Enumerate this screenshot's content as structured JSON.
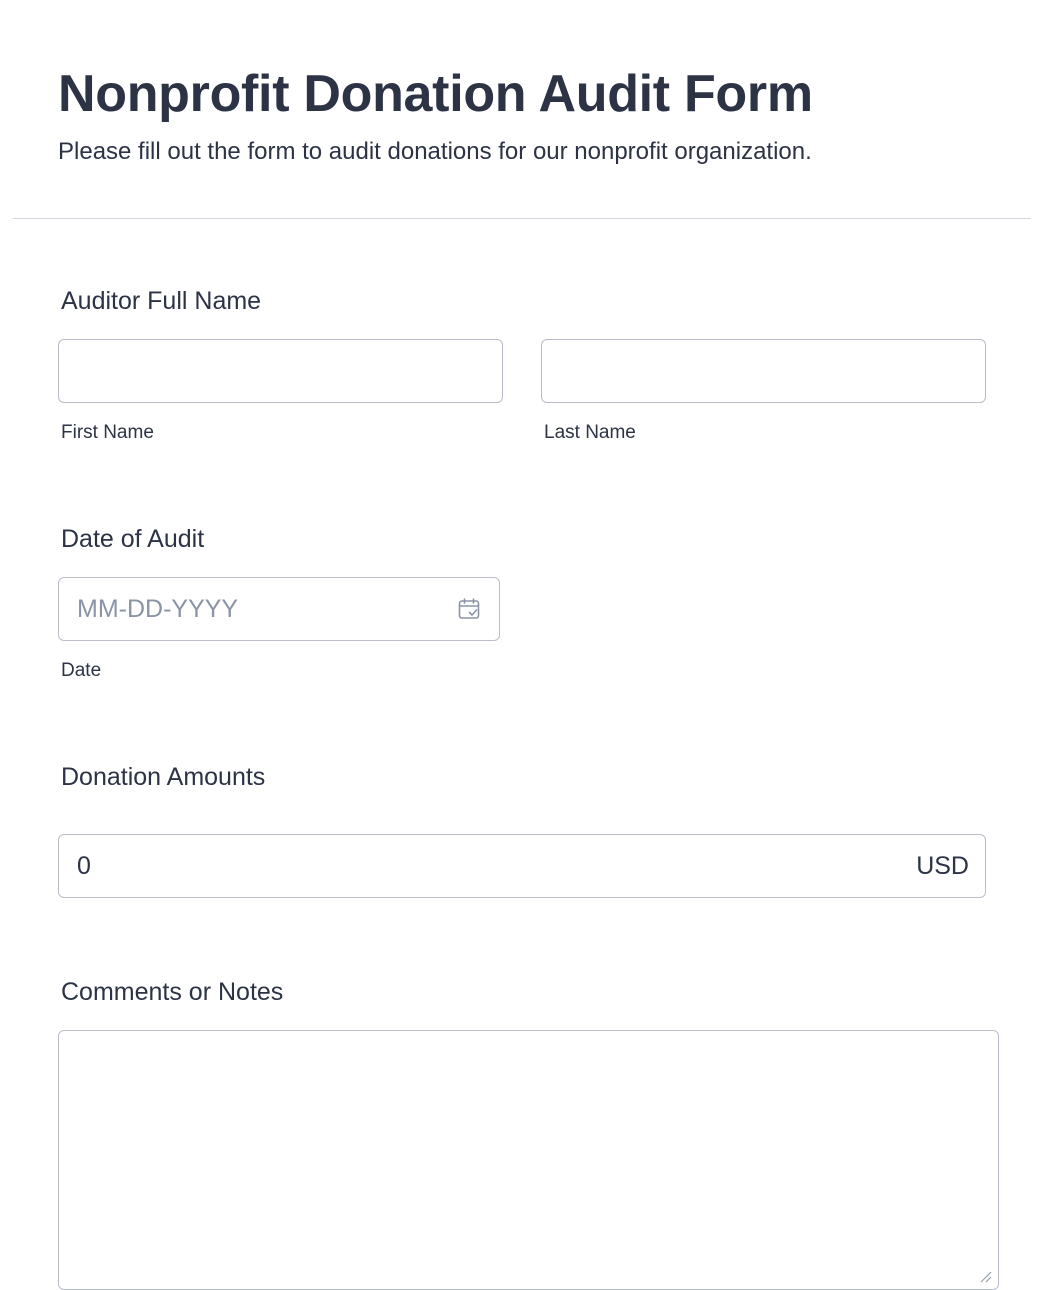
{
  "form": {
    "title": "Nonprofit Donation Audit Form",
    "subtitle": "Please fill out the form to audit donations for our nonprofit organization."
  },
  "auditor_name": {
    "label": "Auditor Full Name",
    "first_name_sublabel": "First Name",
    "last_name_sublabel": "Last Name",
    "first_name_value": "",
    "last_name_value": ""
  },
  "audit_date": {
    "label": "Date of Audit",
    "placeholder": "MM-DD-YYYY",
    "sublabel": "Date",
    "icon": "calendar-icon"
  },
  "donation_amounts": {
    "label": "Donation Amounts",
    "value": "0",
    "currency": "USD"
  },
  "comments": {
    "label": "Comments or Notes",
    "value": ""
  },
  "colors": {
    "text": "#2c3345",
    "border": "#b8bdc9",
    "placeholder": "#8a94a6",
    "divider": "#d3d6dc"
  }
}
